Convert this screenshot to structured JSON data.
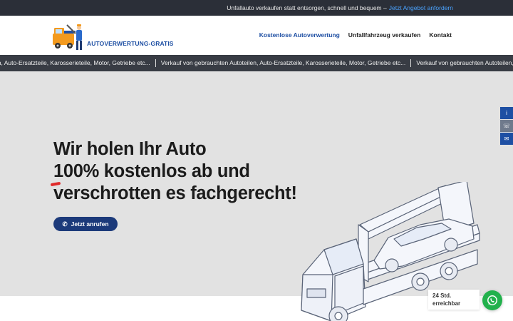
{
  "topbar": {
    "text": "Unfallauto verkaufen statt entsorgen, schnell und bequem –",
    "link": "Jetzt Angebot anfordern"
  },
  "logo": {
    "text": "AUTOVERWERTUNG-GRATIS"
  },
  "nav": {
    "items": [
      {
        "label": "Kostenlose Autoverwertung",
        "active": true
      },
      {
        "label": "Unfallfahrzeug verkaufen",
        "active": false
      },
      {
        "label": "Kontakt",
        "active": false
      }
    ]
  },
  "ticker": {
    "items": [
      "en, Auto-Ersatzteile, Karosserieteile, Motor, Getriebe etc...",
      "Verkauf von gebrauchten Autoteilen, Auto-Ersatzteile, Karosserieteile, Motor, Getriebe etc...",
      "Verkauf von gebrauchten Autoteilen, Auto-Ersatzteile, Karosserieteile, Motor, Getriebe etc..."
    ]
  },
  "hero": {
    "line1": "Wir holen Ihr Auto",
    "line2": "100% kostenlos ab und",
    "line3": "verschrotten es fachgerecht!",
    "cta": "Jetzt anrufen"
  },
  "side_buttons": [
    {
      "icon": "info-icon",
      "glyph": "i",
      "color": "#1e4fa3"
    },
    {
      "icon": "phone-icon",
      "glyph": "☏",
      "color": "#6f7a8c"
    },
    {
      "icon": "mail-icon",
      "glyph": "✉",
      "color": "#1e4fa3"
    }
  ],
  "chat": {
    "line1": "24 Std.",
    "line2": "erreichbar"
  },
  "colors": {
    "brand": "#1e4fa3",
    "cta": "#1c3a7a",
    "topbar": "#2b2f38",
    "ticker": "#383c44",
    "hero_bg": "#e2e2e2",
    "whatsapp": "#22b14c",
    "accent_red": "#e02a2a"
  }
}
